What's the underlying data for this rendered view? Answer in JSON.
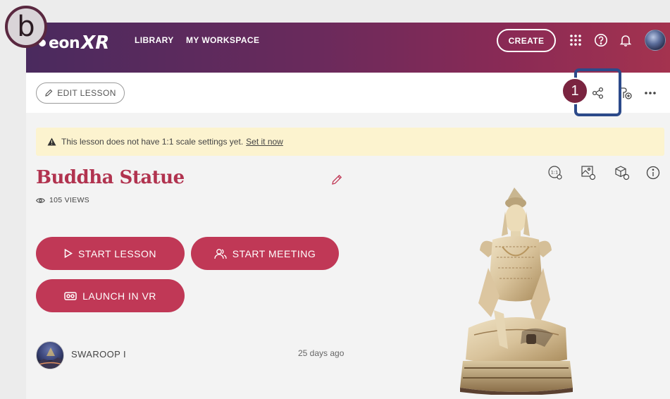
{
  "header": {
    "logo_text": "eon",
    "logo_xr": "XR",
    "nav": [
      "LIBRARY",
      "MY WORKSPACE"
    ],
    "create_label": "CREATE"
  },
  "toolbar": {
    "edit_label": "EDIT LESSON"
  },
  "annotations": {
    "badge_b": "b",
    "callout_1": "1"
  },
  "alert": {
    "message": "This lesson does not have 1:1 scale settings yet.",
    "link": "Set it now"
  },
  "lesson": {
    "title": "Buddha Statue",
    "views": "105 VIEWS",
    "start_lesson": "START LESSON",
    "start_meeting": "START MEETING",
    "launch_vr": "LAUNCH IN VR"
  },
  "author": {
    "name": "SWAROOP I",
    "date": "25 days ago"
  },
  "colors": {
    "accent": "#c03856",
    "title": "#b1334f",
    "alert_bg": "#fcf3cf",
    "callout_frame": "#2c4a8a"
  }
}
